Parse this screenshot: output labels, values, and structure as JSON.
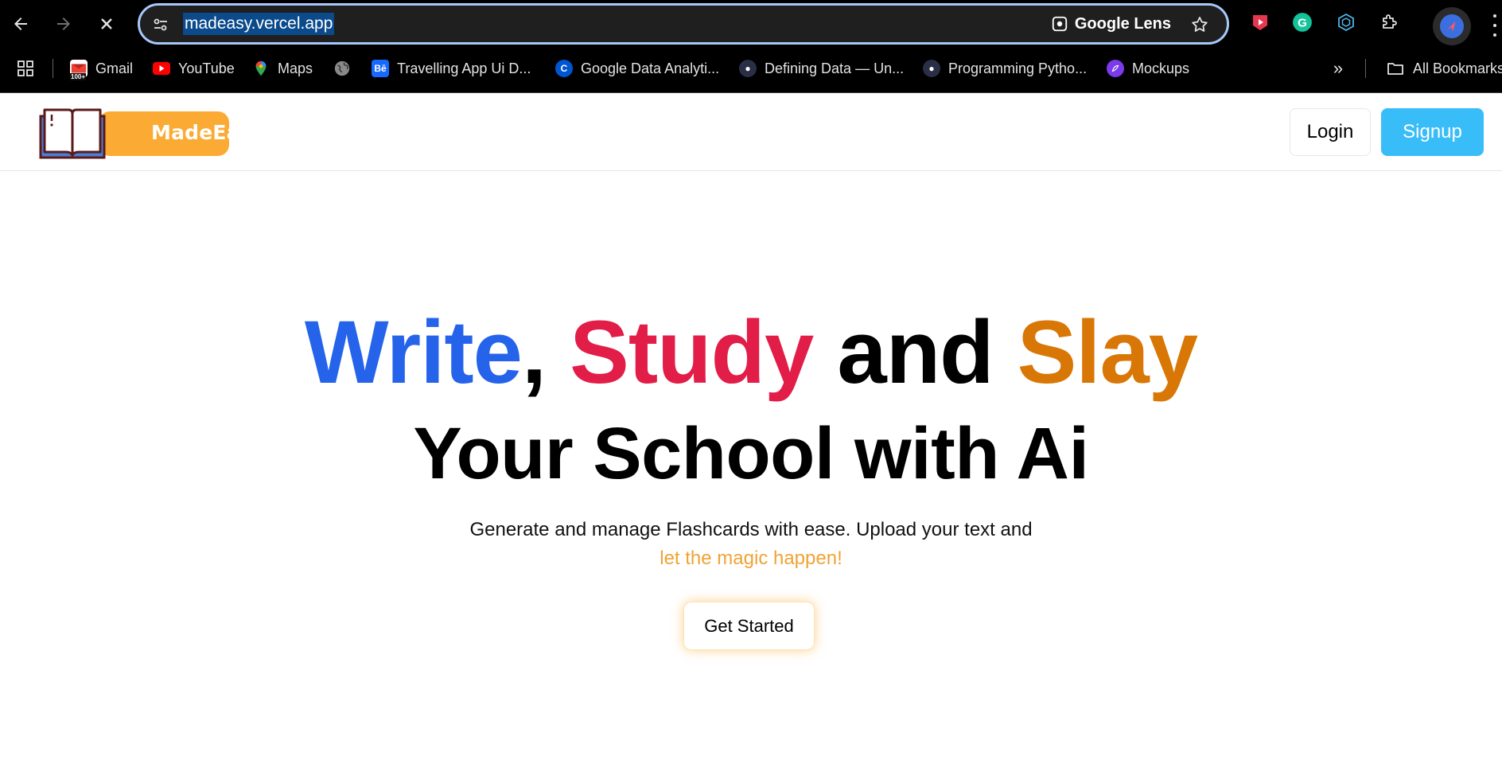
{
  "browser": {
    "url": "madeasy.vercel.app",
    "lens_label": "Google Lens",
    "bookmarks": [
      {
        "label": "Gmail",
        "icon": "gmail-icon"
      },
      {
        "label": "YouTube",
        "icon": "youtube-icon"
      },
      {
        "label": "Maps",
        "icon": "maps-icon"
      },
      {
        "label": "",
        "icon": "globe-icon"
      },
      {
        "label": "Travelling App Ui D...",
        "icon": "behance-icon"
      },
      {
        "label": "Google Data Analyti...",
        "icon": "coursera-icon"
      },
      {
        "label": "Defining Data — Un...",
        "icon": "site-icon"
      },
      {
        "label": "Programming Pytho...",
        "icon": "site-icon"
      },
      {
        "label": "Mockups",
        "icon": "mockups-icon"
      }
    ],
    "all_bookmarks": "All Bookmarks",
    "gmail_badge": "100+",
    "colors": {
      "chrome_bg": "#000000",
      "omnibox_border": "#a8c7fa",
      "url_highlight": "#0b4a8b"
    }
  },
  "site": {
    "logo_text": "MadeEasy",
    "login_label": "Login",
    "signup_label": "Signup",
    "hero": {
      "word1": "Write",
      "comma": ",",
      "word2": "Study",
      "and": "and",
      "word3": "Slay",
      "line2": "Your School with Ai",
      "subtitle": "Generate and manage Flashcards with ease. Upload your text and",
      "subtitle_accent": "let the magic happen!",
      "cta_label": "Get Started"
    },
    "colors": {
      "blue": "#2563eb",
      "red": "#e11d48",
      "orange": "#d97706",
      "accent": "#fbab33",
      "signup_bg": "#38bdf8"
    }
  }
}
